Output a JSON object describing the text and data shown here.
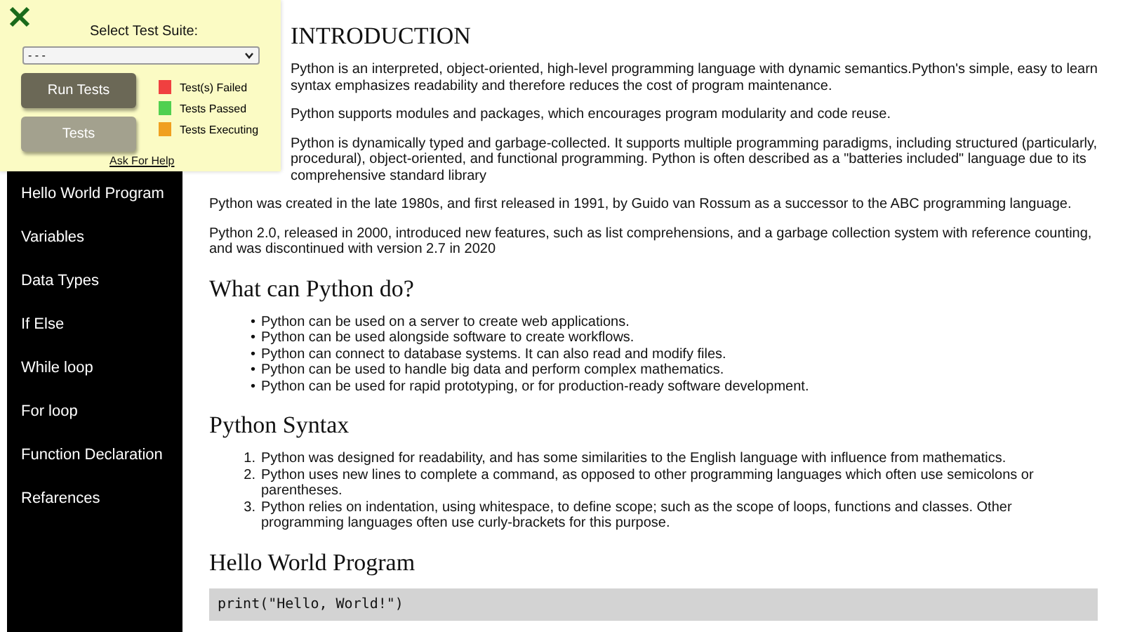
{
  "sidebar": {
    "items": [
      {
        "label": "Hello World Program"
      },
      {
        "label": "Variables"
      },
      {
        "label": "Data Types"
      },
      {
        "label": "If Else"
      },
      {
        "label": "While loop"
      },
      {
        "label": "For loop"
      },
      {
        "label": "Function Declaration"
      },
      {
        "label": "Refarences"
      }
    ]
  },
  "content": {
    "sections": [
      {
        "heading": "INTRODUCTION",
        "blocks": [
          {
            "kind": "paragraph",
            "text": "Python is an interpreted, object-oriented, high-level programming language with dynamic semantics.Python's simple, easy to learn syntax emphasizes readability and therefore reduces the cost of program maintenance."
          },
          {
            "kind": "paragraph",
            "text": "Python supports modules and packages, which encourages program modularity and code reuse."
          },
          {
            "kind": "paragraph",
            "text": "Python is dynamically typed and garbage-collected. It supports multiple programming paradigms, including structured (particularly, procedural), object-oriented, and functional programming. Python is often described as a \"batteries included\" language due to its comprehensive standard library"
          },
          {
            "kind": "paragraph",
            "text": "Python was created in the late 1980s, and first released in 1991, by Guido van Rossum as a successor to the ABC programming language."
          },
          {
            "kind": "paragraph",
            "text": "Python 2.0, released in 2000, introduced new features, such as list comprehensions, and a garbage collection system with reference counting, and was discontinued with version 2.7 in 2020"
          }
        ]
      },
      {
        "heading": "What can Python do?",
        "blocks": [
          {
            "kind": "list",
            "items": [
              {
                "marker": "•",
                "text": "Python can be used on a server to create web applications."
              },
              {
                "marker": "•",
                "text": "Python can be used alongside software to create workflows."
              },
              {
                "marker": "•",
                "text": "Python can connect to database systems. It can also read and modify files."
              },
              {
                "marker": "•",
                "text": "Python can be used to handle big data and perform complex mathematics."
              },
              {
                "marker": "•",
                "text": "Python can be used for rapid prototyping, or for production-ready software development."
              }
            ]
          }
        ]
      },
      {
        "heading": "Python Syntax",
        "blocks": [
          {
            "kind": "list",
            "items": [
              {
                "marker": "1.",
                "text": "Python was designed for readability, and has some similarities to the English language with influence from mathematics."
              },
              {
                "marker": "2.",
                "text": "Python uses new lines to complete a command, as opposed to other programming languages which often use semicolons or parentheses."
              },
              {
                "marker": "3.",
                "text": "Python relies on indentation, using whitespace, to define scope; such as the scope of loops, functions and classes. Other programming languages often use curly-brackets for this purpose."
              }
            ]
          }
        ]
      },
      {
        "heading": "Hello World Program",
        "blocks": [
          {
            "kind": "code",
            "text": "print(\"Hello, World!\")"
          }
        ]
      }
    ]
  },
  "test_panel": {
    "suite_label": "Select Test Suite:",
    "suite_value": "- - -",
    "buttons": [
      {
        "label": "Run Tests",
        "kind": "primary"
      },
      {
        "label": "Tests",
        "kind": "secondary"
      }
    ],
    "legend": [
      {
        "label": "Test(s) Failed",
        "color": "#f04040"
      },
      {
        "label": "Tests Passed",
        "color": "#50d050"
      },
      {
        "label": "Tests Executing",
        "color": "#f0a020"
      }
    ],
    "help_link": "Ask For Help"
  }
}
